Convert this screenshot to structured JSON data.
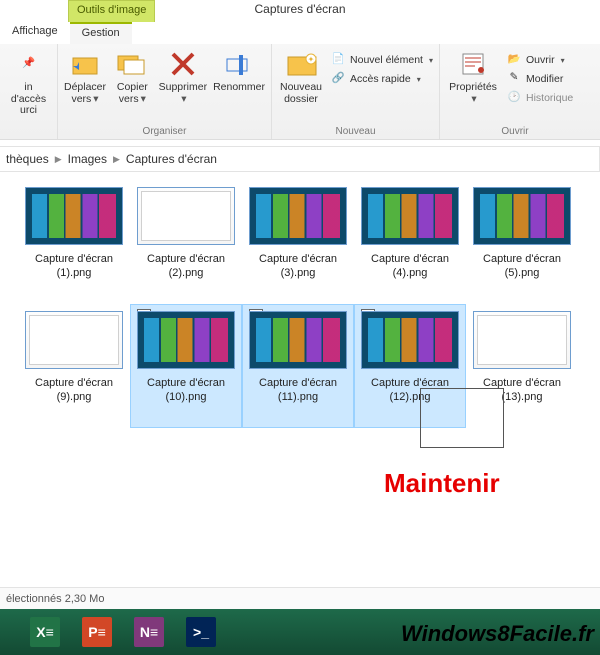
{
  "window": {
    "title": "Captures d'écran"
  },
  "tabs": {
    "tools": "Outils d'image",
    "affichage": "Affichage",
    "gestion": "Gestion"
  },
  "ribbon": {
    "clipboard": {
      "label1": "in d'accès",
      "label2": "urci"
    },
    "organiser": {
      "group": "Organiser",
      "deplacer1": "Déplacer",
      "deplacer2": "vers",
      "copier1": "Copier",
      "copier2": "vers",
      "supprimer": "Supprimer",
      "renommer": "Renommer"
    },
    "nouveau": {
      "group": "Nouveau",
      "dossier1": "Nouveau",
      "dossier2": "dossier",
      "element": "Nouvel élément",
      "acces": "Accès rapide"
    },
    "open": {
      "group": "Ouvrir",
      "props": "Propriétés",
      "ouvrir": "Ouvrir",
      "modifier": "Modifier",
      "historique": "Historique"
    }
  },
  "breadcrumbs": [
    "thèques",
    "Images",
    "Captures d'écran"
  ],
  "files": [
    {
      "name1": "Capture d'écran",
      "name2": "(1).png",
      "thumb": "dark",
      "selected": false
    },
    {
      "name1": "Capture d'écran",
      "name2": "(2).png",
      "thumb": "light",
      "selected": false
    },
    {
      "name1": "Capture d'écran",
      "name2": "(3).png",
      "thumb": "dark",
      "selected": false
    },
    {
      "name1": "Capture d'écran",
      "name2": "(4).png",
      "thumb": "dark",
      "selected": false
    },
    {
      "name1": "Capture d'écran",
      "name2": "(5).png",
      "thumb": "dark",
      "selected": false
    },
    {
      "name1": "Capture d'écran",
      "name2": "(9).png",
      "thumb": "light",
      "selected": false
    },
    {
      "name1": "Capture d'écran",
      "name2": "(10).png",
      "thumb": "dark",
      "selected": true
    },
    {
      "name1": "Capture d'écran",
      "name2": "(11).png",
      "thumb": "dark",
      "selected": true
    },
    {
      "name1": "Capture d'écran",
      "name2": "(12).png",
      "thumb": "dark",
      "selected": true
    },
    {
      "name1": "Capture d'écran",
      "name2": "(13).png",
      "thumb": "light",
      "selected": false
    }
  ],
  "annotation": "Maintenir",
  "status": "électionnés  2,30 Mo",
  "brand": "Windows8Facile.fr",
  "colors": {
    "accent": "#1e6a4a",
    "select": "#cce8ff",
    "annotation": "#e60000"
  }
}
